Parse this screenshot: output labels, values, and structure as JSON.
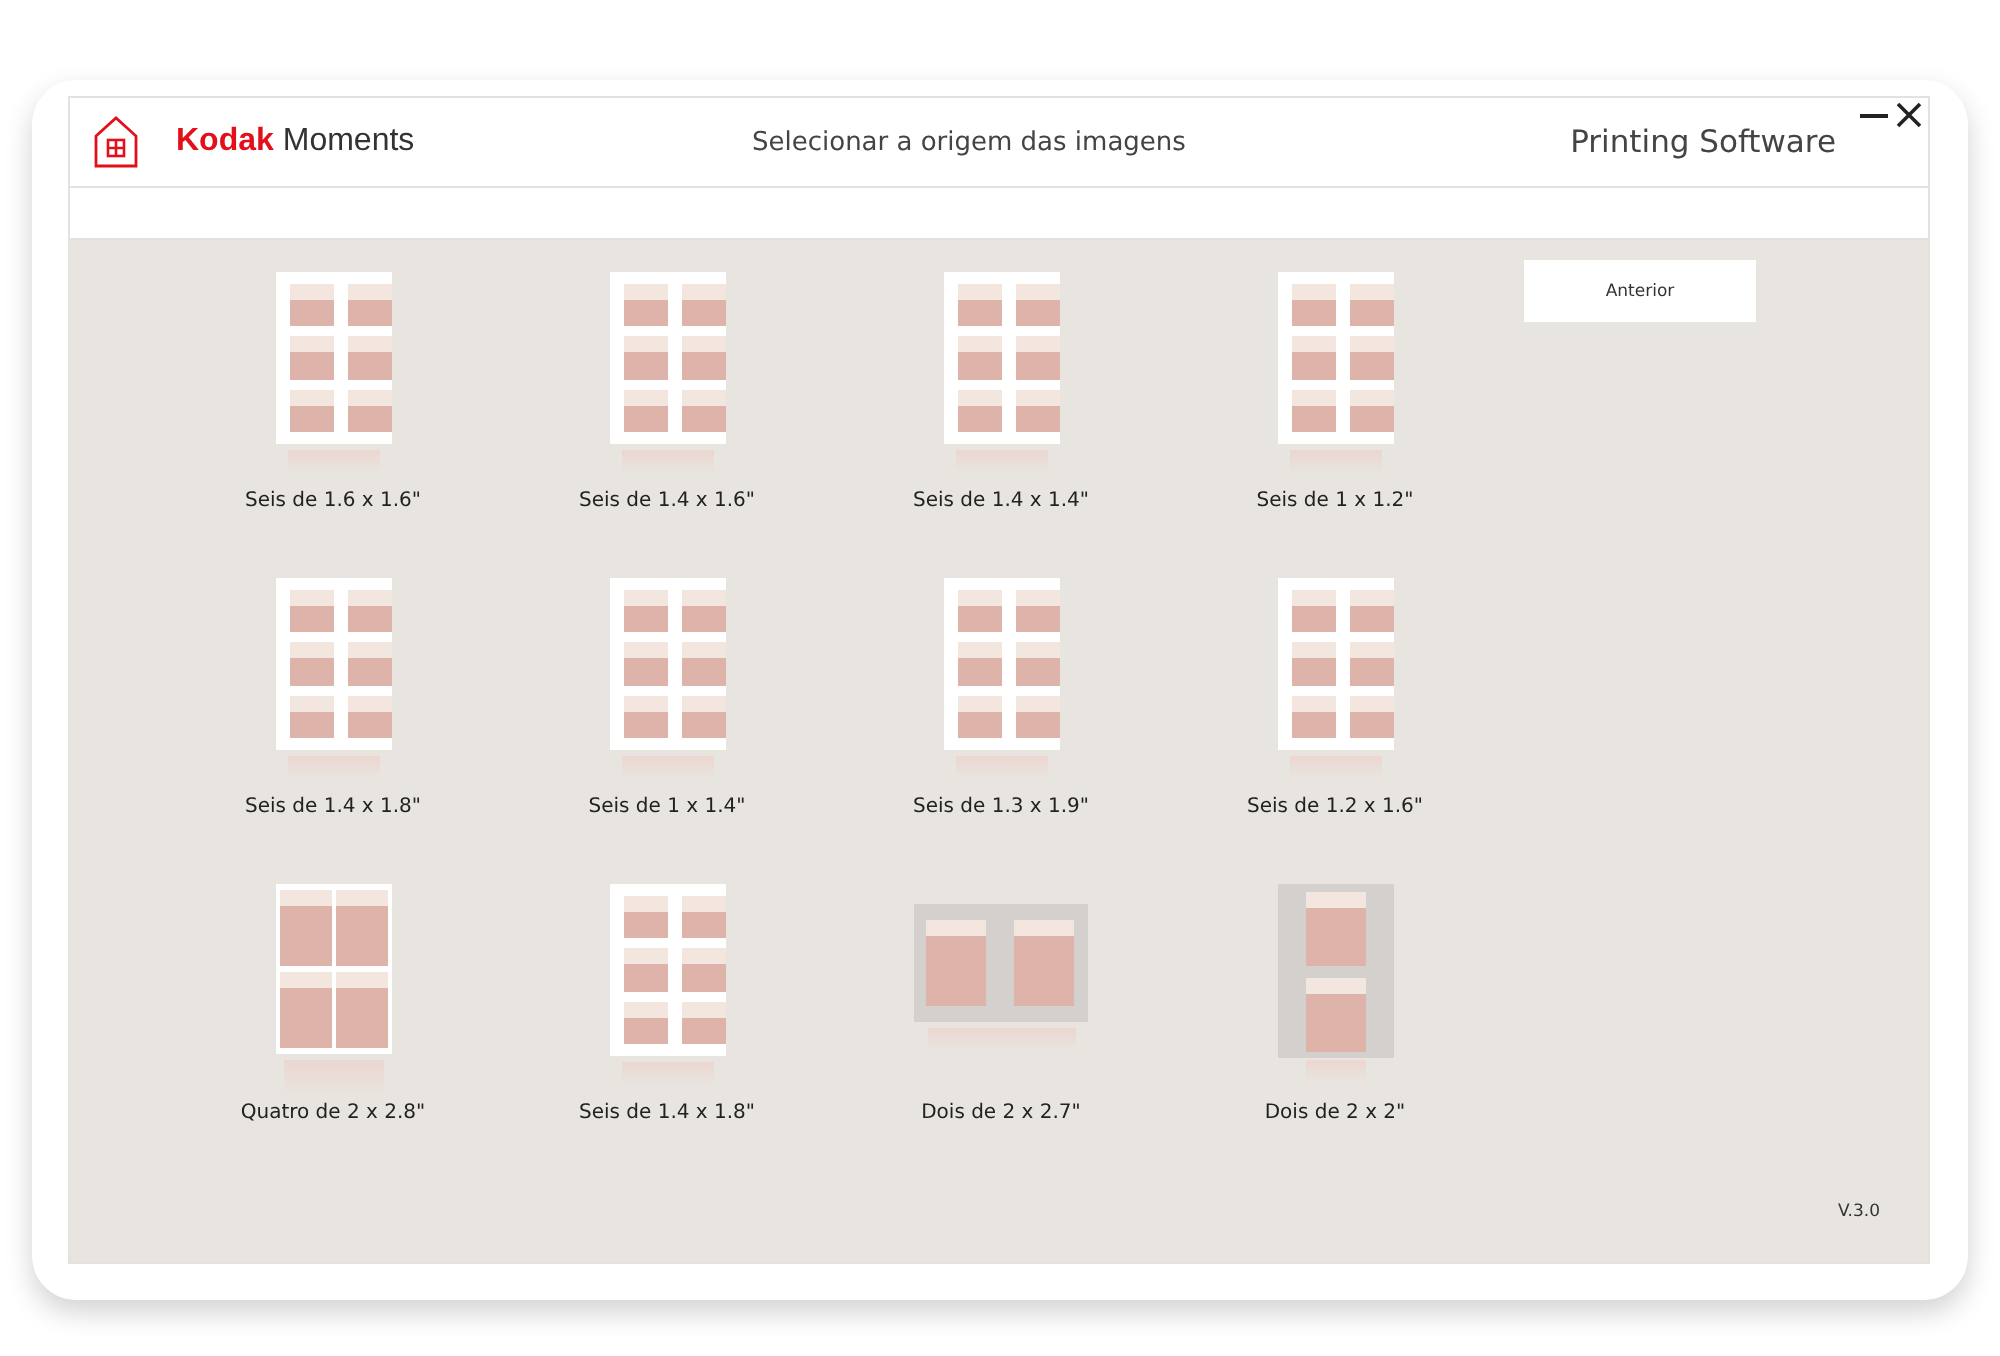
{
  "header": {
    "logo_brand": "Kodak",
    "logo_product": "Moments",
    "title": "Selecionar a origem das imagens",
    "app_name": "Printing Software"
  },
  "layouts": [
    {
      "label": "Seis de 1.6 x 1.6\"",
      "kind": "six"
    },
    {
      "label": "Seis de 1.4 x 1.6\"",
      "kind": "six"
    },
    {
      "label": "Seis de 1.4 x 1.4\"",
      "kind": "six"
    },
    {
      "label": "Seis de 1 x 1.2\"",
      "kind": "six"
    },
    {
      "label": "Seis de 1.4 x 1.8\"",
      "kind": "six"
    },
    {
      "label": "Seis de 1 x 1.4\"",
      "kind": "six"
    },
    {
      "label": "Seis de 1.3 x 1.9\"",
      "kind": "six"
    },
    {
      "label": "Seis de 1.2 x 1.6\"",
      "kind": "six"
    },
    {
      "label": "Quatro de 2 x 2.8\"",
      "kind": "four"
    },
    {
      "label": "Seis de 1.4 x 1.8\"",
      "kind": "six"
    },
    {
      "label": "Dois de 2 x 2.7\"",
      "kind": "pair-row"
    },
    {
      "label": "Dois de 2 x 2\"",
      "kind": "pair-column"
    }
  ],
  "back_button": "Anterior",
  "version": "V.3.0"
}
